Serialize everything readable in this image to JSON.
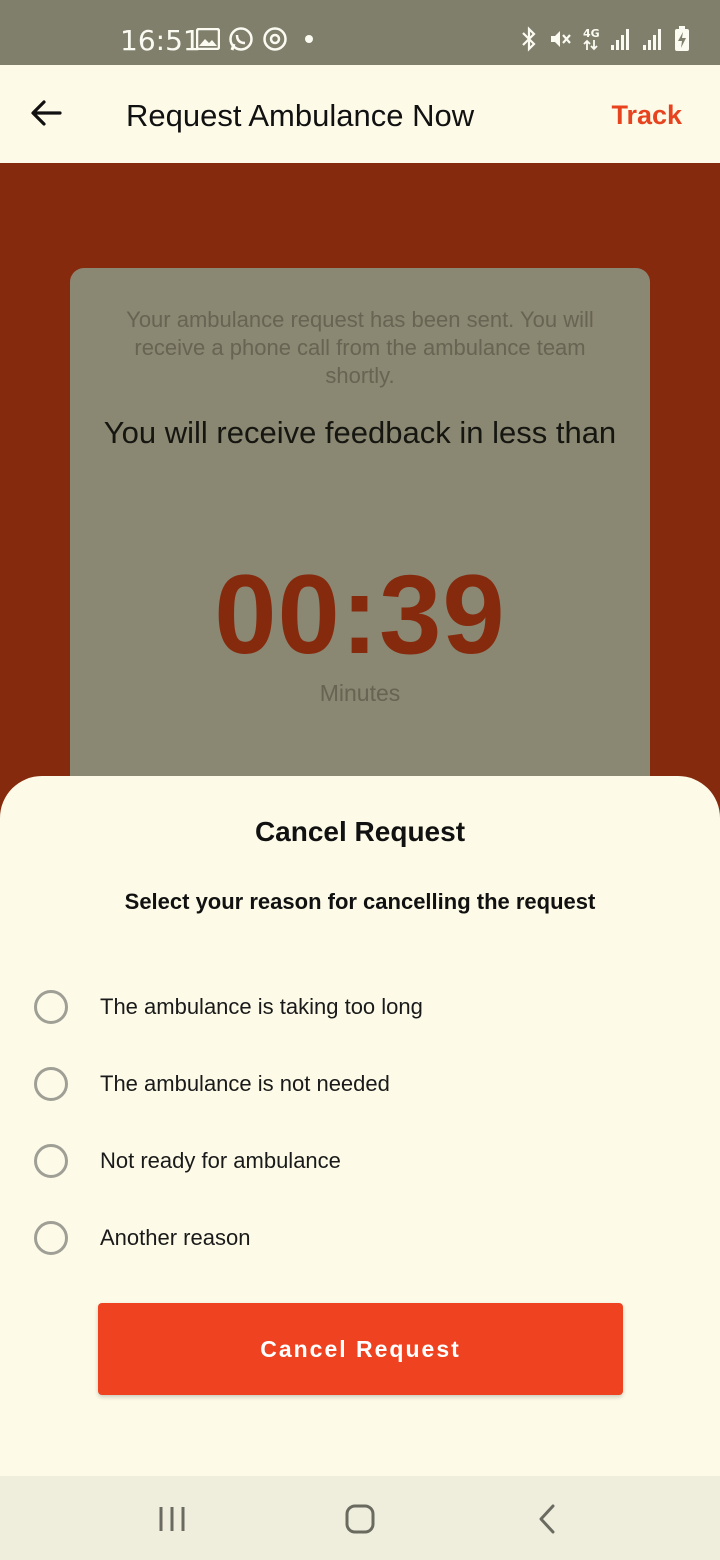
{
  "status_bar": {
    "time": "16:51",
    "left_icons": [
      "image-icon",
      "whatsapp-icon",
      "sync-icon",
      "dot-icon"
    ],
    "right_icons": [
      "bluetooth-icon",
      "mute-icon",
      "network-4g-icon",
      "signal-icon",
      "signal-icon",
      "battery-charging-icon"
    ]
  },
  "app_bar": {
    "back_icon": "arrow-left-icon",
    "title": "Request Ambulance Now",
    "track_label": "Track"
  },
  "status_card": {
    "sent_message": "Your ambulance request has been sent. You will receive a phone call from the ambulance team shortly.",
    "feedback_message": "You will receive feedback in less than",
    "countdown": "00:39",
    "unit": "Minutes"
  },
  "cancel_sheet": {
    "title": "Cancel Request",
    "subtitle": "Select your reason for cancelling the request",
    "options": [
      {
        "label": "The ambulance is taking too long",
        "selected": false
      },
      {
        "label": "The ambulance is not needed",
        "selected": false
      },
      {
        "label": "Not ready for ambulance",
        "selected": false
      },
      {
        "label": "Another reason",
        "selected": false
      }
    ],
    "button_label": "Cancel Request"
  },
  "nav_bar": {
    "icons": [
      "recents-icon",
      "home-icon",
      "back-icon"
    ]
  },
  "colors": {
    "accent": "#ee4221",
    "hero_background": "#862a0d",
    "card_background": "#8a8772",
    "sheet_background": "#fdfbe8"
  }
}
